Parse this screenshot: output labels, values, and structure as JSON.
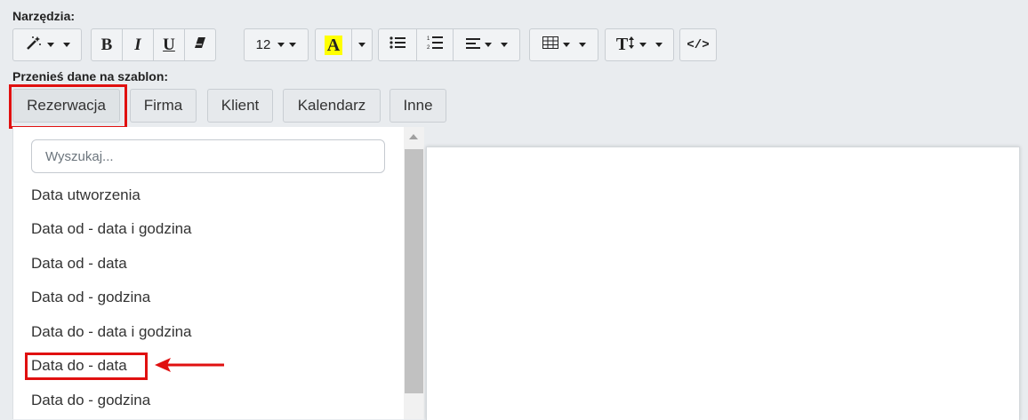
{
  "tools_label": "Narzędzia:",
  "toolbar": {
    "font_size": "12",
    "highlight_letter": "A",
    "highlight_color": "#ffff00",
    "bold": "B",
    "italic": "I",
    "underline": "U",
    "code": "</>",
    "text_size": "T"
  },
  "transfer_label": "Przenieś dane na szablon:",
  "tabs": [
    {
      "label": "Rezerwacja"
    },
    {
      "label": "Firma"
    },
    {
      "label": "Klient"
    },
    {
      "label": "Kalendarz"
    },
    {
      "label": "Inne"
    }
  ],
  "search": {
    "placeholder": "Wyszukaj..."
  },
  "fields": [
    {
      "label": "Data utworzenia"
    },
    {
      "label": "Data od - data i godzina"
    },
    {
      "label": "Data od - data"
    },
    {
      "label": "Data od - godzina"
    },
    {
      "label": "Data do - data i godzina"
    },
    {
      "label": "Data do - data"
    },
    {
      "label": "Data do - godzina"
    }
  ],
  "highlight_color": "#e01010"
}
